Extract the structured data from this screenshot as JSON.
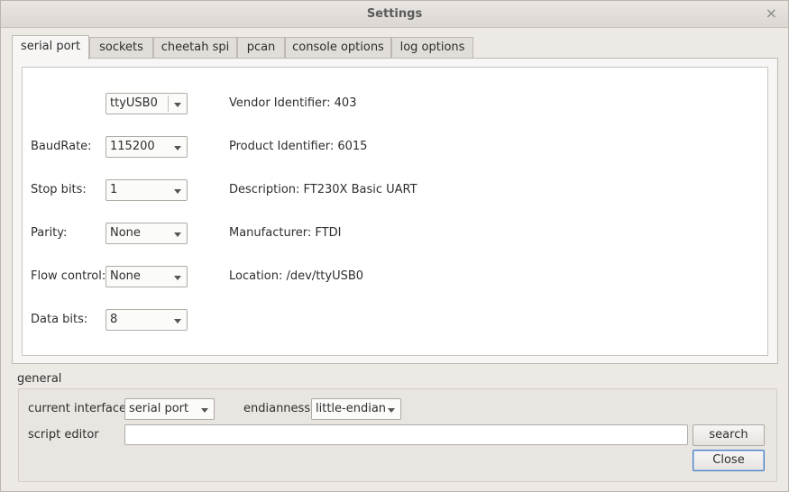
{
  "window": {
    "title": "Settings",
    "close_glyph": "×"
  },
  "tabs": [
    {
      "label": "serial port",
      "active": true
    },
    {
      "label": "sockets",
      "active": false
    },
    {
      "label": "cheetah spi",
      "active": false
    },
    {
      "label": "pcan",
      "active": false
    },
    {
      "label": "console options",
      "active": false
    },
    {
      "label": "log options",
      "active": false
    }
  ],
  "serial": {
    "port": {
      "value": "ttyUSB0"
    },
    "baud": {
      "label": "BaudRate:",
      "value": "115200"
    },
    "stop_bits": {
      "label": "Stop bits:",
      "value": "1"
    },
    "parity": {
      "label": "Parity:",
      "value": "None"
    },
    "flow_control": {
      "label": "Flow control:",
      "value": "None"
    },
    "data_bits": {
      "label": "Data bits:",
      "value": "8"
    },
    "info": {
      "vendor": "Vendor Identifier: 403",
      "product": "Product Identifier: 6015",
      "description": "Description: FT230X Basic UART",
      "manufacturer": "Manufacturer: FTDI",
      "location": "Location: /dev/ttyUSB0"
    }
  },
  "general": {
    "title": "general",
    "current_interface": {
      "label": "current interface",
      "value": "serial port"
    },
    "endianness": {
      "label": "endianness",
      "value": "little-endian"
    },
    "script_editor": {
      "label": "script editor",
      "value": "",
      "placeholder": ""
    },
    "search_label": "search",
    "close_label": "Close"
  }
}
